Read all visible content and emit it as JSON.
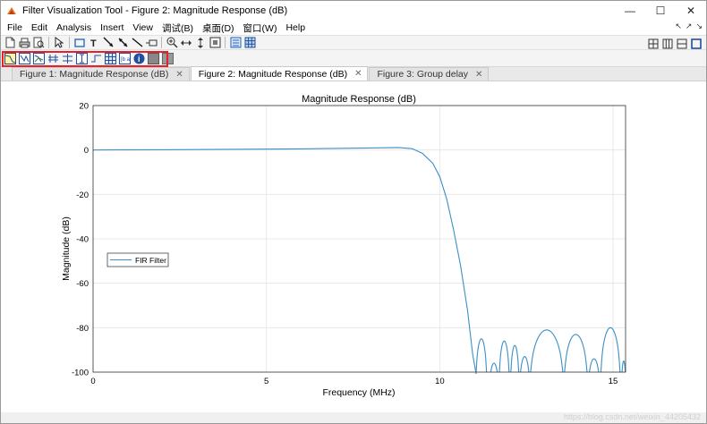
{
  "window": {
    "title": "Filter Visualization Tool - Figure 2: Magnitude Response (dB)",
    "controls": {
      "minimize": "—",
      "maximize": "☐",
      "close": "✕"
    }
  },
  "menu": {
    "items": [
      "File",
      "Edit",
      "Analysis",
      "Insert",
      "View",
      "调试(B)",
      "桌面(D)",
      "窗口(W)",
      "Help"
    ],
    "right": [
      "↖",
      "↗",
      "↘"
    ]
  },
  "toolbar1": {
    "left_icons": [
      "new-document-icon",
      "print-icon",
      "print-preview-icon",
      "pointer-icon",
      "rectangle-icon",
      "text-icon",
      "arrow-icon",
      "double-arrow-icon",
      "line-icon",
      "pin-icon",
      "zoom-in-icon",
      "zoom-out-icon",
      "zoom-x-icon",
      "zoom-y-icon",
      "full-view-icon",
      "grid-icon"
    ],
    "right_icons": [
      "tile-icon",
      "split-columns-icon",
      "split-rows-icon",
      "maximize-icon"
    ]
  },
  "toolbar2": {
    "icons": [
      "magnitude-response-icon",
      "phase-response-icon",
      "magnitude-phase-icon",
      "group-delay-icon",
      "phase-delay-icon",
      "impulse-response-icon",
      "step-response-icon",
      "pole-zero-icon",
      "coefficients-icon",
      "info-icon",
      "properties-icon",
      "export-icon"
    ],
    "highlight_color": "#e8202a"
  },
  "tabs": [
    {
      "label": "Figure 1: Magnitude Response (dB)",
      "active": false
    },
    {
      "label": "Figure 2: Magnitude Response (dB)",
      "active": true
    },
    {
      "label": "Figure 3: Group delay",
      "active": false
    }
  ],
  "chart_data": {
    "type": "line",
    "title": "Magnitude Response (dB)",
    "xlabel": "Frequency (MHz)",
    "ylabel": "Magnitude (dB)",
    "xlim": [
      0,
      15.36
    ],
    "ylim": [
      -100,
      20
    ],
    "xticks": [
      0,
      5,
      10,
      15
    ],
    "yticks": [
      20,
      0,
      -20,
      -40,
      -60,
      -80,
      -100
    ],
    "grid": true,
    "legend": {
      "placement": "middle-left",
      "entries": [
        "FIR Filter"
      ]
    },
    "series": [
      {
        "name": "FIR Filter",
        "color": "#3b8fc6",
        "x": [
          0,
          2,
          4,
          6,
          8,
          8.8,
          9.2,
          9.5,
          9.8,
          10.0,
          10.2,
          10.4,
          10.6,
          10.8,
          10.95,
          11.05
        ],
        "y": [
          0,
          0.1,
          0.3,
          0.5,
          0.9,
          1.1,
          0.6,
          -1.5,
          -6,
          -12,
          -22,
          -36,
          -52,
          -72,
          -92,
          -101
        ]
      },
      {
        "name": "",
        "color": "#3b8fc6",
        "lobes": [
          {
            "x0": 11.05,
            "x1": 11.35,
            "peak": -85
          },
          {
            "x0": 11.45,
            "x1": 11.68,
            "peak": -96
          },
          {
            "x0": 11.72,
            "x1": 12.0,
            "peak": -86
          },
          {
            "x0": 12.05,
            "x1": 12.28,
            "peak": -88
          },
          {
            "x0": 12.32,
            "x1": 12.58,
            "peak": -93
          },
          {
            "x0": 12.62,
            "x1": 13.55,
            "peak": -81
          },
          {
            "x0": 13.6,
            "x1": 14.25,
            "peak": -83
          },
          {
            "x0": 14.3,
            "x1": 14.6,
            "peak": -94
          },
          {
            "x0": 14.65,
            "x1": 15.2,
            "peak": -80
          },
          {
            "x0": 15.25,
            "x1": 15.36,
            "peak": -95
          }
        ]
      }
    ]
  },
  "watermark": "https://blog.csdn.net/weixin_44205432"
}
